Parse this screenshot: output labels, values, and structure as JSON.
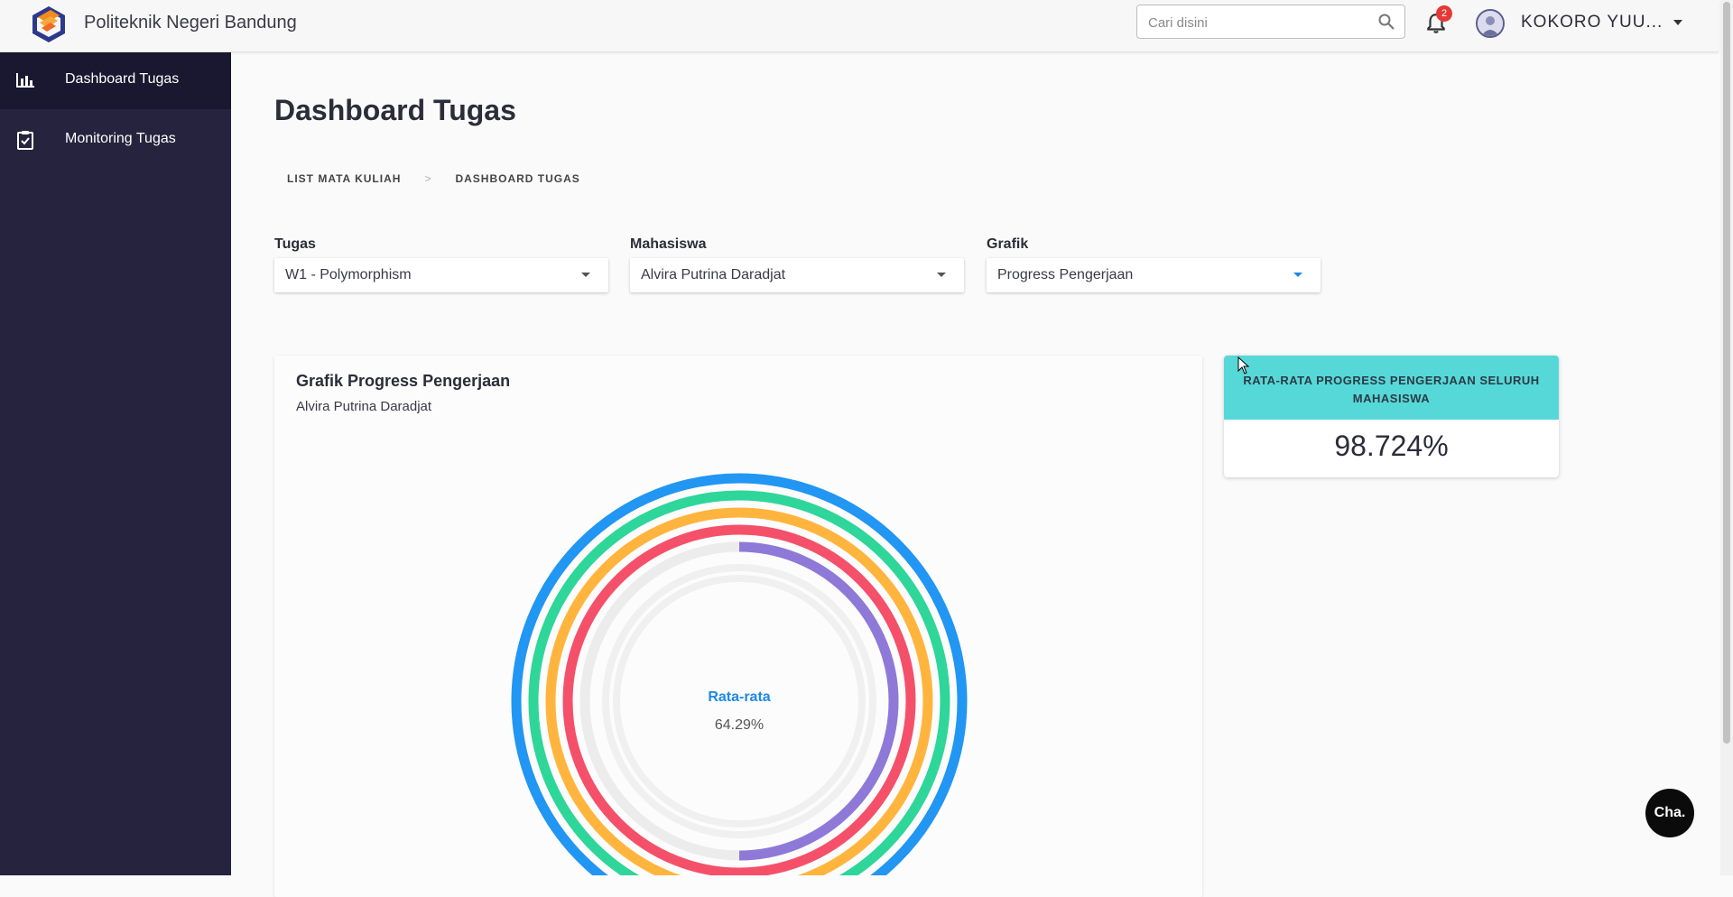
{
  "app": {
    "brand": "Politeknik Negeri Bandung"
  },
  "search": {
    "placeholder": "Cari disini"
  },
  "notifications": {
    "count": "2"
  },
  "user": {
    "name": "KOKORO YUU..."
  },
  "sidebar": {
    "items": [
      {
        "label": "Dashboard Tugas",
        "icon": "bar-chart-icon",
        "active": true
      },
      {
        "label": "Monitoring Tugas",
        "icon": "clipboard-check-icon",
        "active": false
      }
    ]
  },
  "page": {
    "title": "Dashboard Tugas"
  },
  "breadcrumb": {
    "items": [
      "LIST MATA KULIAH",
      "DASHBOARD TUGAS"
    ],
    "separator": ">"
  },
  "filters": {
    "tugas": {
      "label": "Tugas",
      "value": "W1 - Polymorphism"
    },
    "mahasiswa": {
      "label": "Mahasiswa",
      "value": "Alvira Putrina Daradjat"
    },
    "grafik": {
      "label": "Grafik",
      "value": "Progress Pengerjaan"
    }
  },
  "chart_card": {
    "title": "Grafik Progress Pengerjaan",
    "subtitle": "Alvira Putrina Daradjat"
  },
  "chart_data": {
    "type": "radialBar",
    "center_label": "Rata-rata",
    "center_value": "64.29%",
    "series": [
      {
        "value": 100,
        "color": "#2196f3"
      },
      {
        "value": 100,
        "color": "#2ed69a"
      },
      {
        "value": 100,
        "color": "#ffb53d"
      },
      {
        "value": 100,
        "color": "#f5506a"
      },
      {
        "value": 50,
        "color": "#8e79d8"
      }
    ],
    "track_color": "#ececec"
  },
  "stat_card": {
    "title": "RATA-RATA PROGRESS PENGERJAAN SELURUH MAHASISWA",
    "value": "98.724%"
  },
  "chat": {
    "label": "Cha."
  },
  "colors": {
    "sidebar": "#25233d",
    "sidebar_active": "#1a1830",
    "stat_head": "#56d8d8",
    "accent": "#2196f3"
  }
}
